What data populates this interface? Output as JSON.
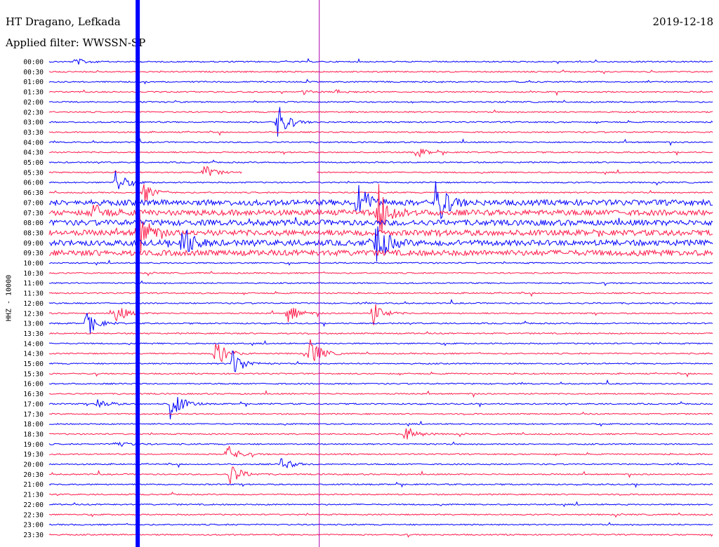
{
  "header": {
    "station": "HT Dragano, Lefkada",
    "filter": "Applied filter: WWSSN-SP",
    "date": "2019-12-18",
    "channel_label": "HHZ - 10000"
  },
  "chart_data": {
    "type": "line",
    "title": "HT Dragano, Lefkada",
    "subtitle": "Applied filter: WWSSN-SP",
    "ylabel": "HHZ - 10000",
    "trace_colors": [
      "#0000ff",
      "#ff1a4a"
    ],
    "marker_color": "#b000b0",
    "categories": [
      "00:00",
      "00:30",
      "01:00",
      "01:30",
      "02:00",
      "02:30",
      "03:00",
      "03:30",
      "04:00",
      "04:30",
      "05:00",
      "05:30",
      "06:00",
      "06:30",
      "07:00",
      "07:30",
      "08:00",
      "08:30",
      "09:00",
      "09:30",
      "10:00",
      "10:30",
      "11:00",
      "11:30",
      "12:00",
      "12:30",
      "13:00",
      "13:30",
      "14:00",
      "14:30",
      "15:00",
      "15:30",
      "16:00",
      "16:30",
      "17:00",
      "17:30",
      "18:00",
      "18:30",
      "19:00",
      "19:30",
      "20:00",
      "20:30",
      "21:00",
      "21:30",
      "22:00",
      "22:30",
      "23:00",
      "23:30"
    ],
    "x_range_minutes": [
      0,
      30
    ],
    "events": [
      {
        "row": "00:00",
        "minute": 1.2,
        "amplitude": 5
      },
      {
        "row": "01:30",
        "minute": 11.5,
        "amplitude": 3
      },
      {
        "row": "01:30",
        "minute": 13.0,
        "amplitude": 3
      },
      {
        "row": "03:00",
        "minute": 10.3,
        "amplitude": 28
      },
      {
        "row": "04:30",
        "minute": 16.6,
        "amplitude": 8
      },
      {
        "row": "05:30",
        "minute": 7.0,
        "amplitude": 12
      },
      {
        "row": "06:00",
        "minute": 3.0,
        "amplitude": 18
      },
      {
        "row": "06:30",
        "minute": 4.3,
        "amplitude": 15
      },
      {
        "row": "07:00",
        "minute": 13.9,
        "amplitude": 35
      },
      {
        "row": "07:00",
        "minute": 17.5,
        "amplitude": 40
      },
      {
        "row": "07:30",
        "minute": 2.0,
        "amplitude": 12
      },
      {
        "row": "07:30",
        "minute": 14.9,
        "amplitude": 45
      },
      {
        "row": "08:30",
        "minute": 4.0,
        "amplitude": 40
      },
      {
        "row": "09:00",
        "minute": 6.0,
        "amplitude": 30
      },
      {
        "row": "09:00",
        "minute": 14.8,
        "amplitude": 35
      },
      {
        "row": "13:00",
        "minute": 1.7,
        "amplitude": 20
      },
      {
        "row": "12:30",
        "minute": 3.0,
        "amplitude": 16
      },
      {
        "row": "12:30",
        "minute": 10.8,
        "amplitude": 16
      },
      {
        "row": "12:30",
        "minute": 14.6,
        "amplitude": 20
      },
      {
        "row": "14:30",
        "minute": 7.5,
        "amplitude": 24
      },
      {
        "row": "15:00",
        "minute": 8.3,
        "amplitude": 22
      },
      {
        "row": "14:30",
        "minute": 11.8,
        "amplitude": 24
      },
      {
        "row": "17:00",
        "minute": 5.5,
        "amplitude": 28
      },
      {
        "row": "17:00",
        "minute": 2.2,
        "amplitude": 8
      },
      {
        "row": "18:30",
        "minute": 16.1,
        "amplitude": 14
      },
      {
        "row": "19:30",
        "minute": 8.0,
        "amplitude": 16
      },
      {
        "row": "20:00",
        "minute": 10.5,
        "amplitude": 10
      },
      {
        "row": "20:30",
        "minute": 8.2,
        "amplitude": 18
      },
      {
        "row": "19:00",
        "minute": 3.0,
        "amplitude": 6
      }
    ],
    "marker_minute": 12.2,
    "clipped_minute": 4.0,
    "gap": {
      "row": "06:00",
      "minute_start": 8.7,
      "minute_end": 12.1
    },
    "grid": false,
    "legend": "none"
  }
}
